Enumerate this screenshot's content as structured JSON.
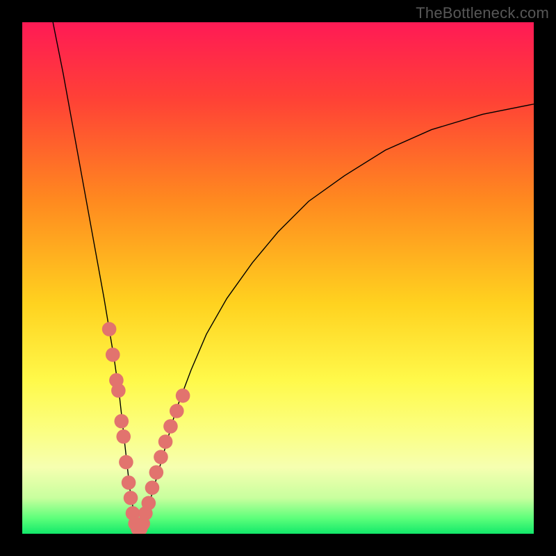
{
  "watermark": "TheBottleneck.com",
  "chart_data": {
    "type": "line",
    "title": "",
    "xlabel": "",
    "ylabel": "",
    "xlim": [
      0,
      100
    ],
    "ylim": [
      0,
      100
    ],
    "grid": false,
    "legend": false,
    "background_gradient_stops": [
      {
        "pct": 0,
        "color": "#ff1a55"
      },
      {
        "pct": 15,
        "color": "#ff4136"
      },
      {
        "pct": 35,
        "color": "#ff8a1f"
      },
      {
        "pct": 55,
        "color": "#ffd21f"
      },
      {
        "pct": 70,
        "color": "#fff94a"
      },
      {
        "pct": 80,
        "color": "#fbff82"
      },
      {
        "pct": 87,
        "color": "#f6ffb0"
      },
      {
        "pct": 93,
        "color": "#c8ff9e"
      },
      {
        "pct": 97,
        "color": "#5cff7a"
      },
      {
        "pct": 100,
        "color": "#12e86a"
      }
    ],
    "series": [
      {
        "name": "bottleneck-curve",
        "color": "#000000",
        "x": [
          6,
          8,
          10,
          12,
          14,
          16,
          18,
          19,
          20,
          21,
          22,
          23,
          24,
          26,
          28,
          30,
          33,
          36,
          40,
          45,
          50,
          56,
          63,
          71,
          80,
          90,
          100
        ],
        "y": [
          100,
          90,
          79,
          68,
          57,
          46,
          34,
          27,
          18,
          9,
          3,
          1,
          3,
          10,
          17,
          24,
          32,
          39,
          46,
          53,
          59,
          65,
          70,
          75,
          79,
          82,
          84
        ]
      }
    ],
    "markers": {
      "name": "curve-dots",
      "color": "#e2736e",
      "radius": 1.4,
      "points": [
        {
          "x": 17.0,
          "y": 40
        },
        {
          "x": 17.7,
          "y": 35
        },
        {
          "x": 18.4,
          "y": 30
        },
        {
          "x": 18.8,
          "y": 28
        },
        {
          "x": 19.4,
          "y": 22
        },
        {
          "x": 19.8,
          "y": 19
        },
        {
          "x": 20.3,
          "y": 14
        },
        {
          "x": 20.8,
          "y": 10
        },
        {
          "x": 21.2,
          "y": 7
        },
        {
          "x": 21.6,
          "y": 4
        },
        {
          "x": 22.1,
          "y": 2
        },
        {
          "x": 22.6,
          "y": 1
        },
        {
          "x": 23.1,
          "y": 1
        },
        {
          "x": 23.6,
          "y": 2
        },
        {
          "x": 24.1,
          "y": 4
        },
        {
          "x": 24.7,
          "y": 6
        },
        {
          "x": 25.4,
          "y": 9
        },
        {
          "x": 26.2,
          "y": 12
        },
        {
          "x": 27.1,
          "y": 15
        },
        {
          "x": 28.0,
          "y": 18
        },
        {
          "x": 29.0,
          "y": 21
        },
        {
          "x": 30.2,
          "y": 24
        },
        {
          "x": 31.4,
          "y": 27
        }
      ]
    }
  }
}
